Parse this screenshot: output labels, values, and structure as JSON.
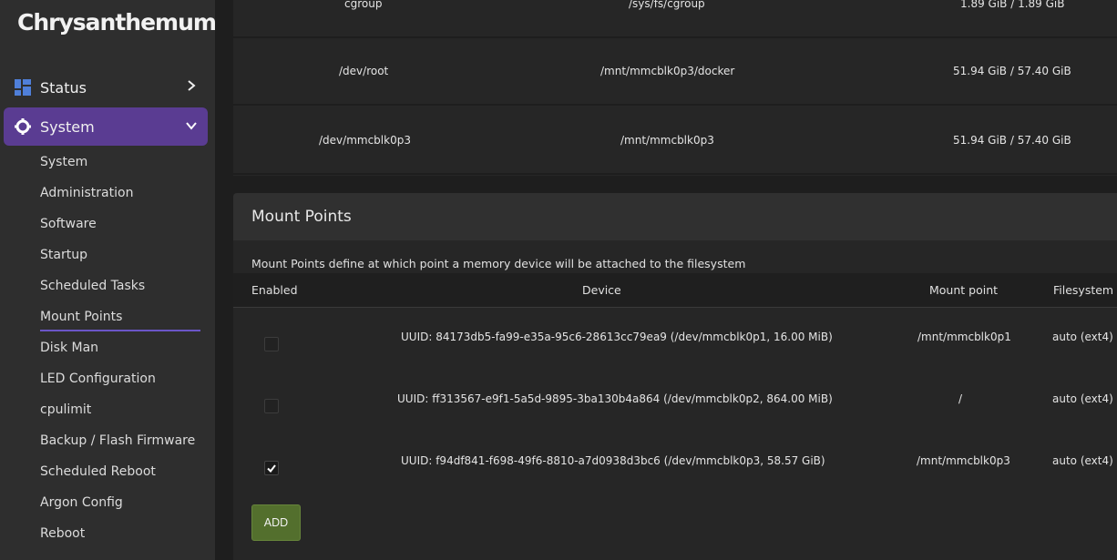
{
  "brand": "Chrysanthemum",
  "nav": {
    "status_label": "Status",
    "system_label": "System",
    "sub_items": [
      "System",
      "Administration",
      "Software",
      "Startup",
      "Scheduled Tasks",
      "Mount Points",
      "Disk Man",
      "LED Configuration",
      "cpulimit",
      "Backup / Flash Firmware",
      "Scheduled Reboot",
      "Argon Config",
      "Reboot"
    ]
  },
  "disk_rows": [
    {
      "fs": "cgroup",
      "mount": "/sys/fs/cgroup",
      "usage": "1.89 GiB / 1.89 GiB"
    },
    {
      "fs": "/dev/root",
      "mount": "/mnt/mmcblk0p3/docker",
      "usage": "51.94 GiB / 57.40 GiB"
    },
    {
      "fs": "/dev/mmcblk0p3",
      "mount": "/mnt/mmcblk0p3",
      "usage": "51.94 GiB / 57.40 GiB"
    }
  ],
  "mount_points": {
    "title": "Mount Points",
    "description": "Mount Points define at which point a memory device will be attached to the filesystem",
    "headers": {
      "enabled": "Enabled",
      "device": "Device",
      "mount_point": "Mount point",
      "filesystem": "Filesystem"
    },
    "rows": [
      {
        "enabled": false,
        "device": "UUID: 84173db5-fa99-e35a-95c6-28613cc79ea9 (/dev/mmcblk0p1, 16.00 MiB)",
        "mount_point": "/mnt/mmcblk0p1",
        "filesystem": "auto (ext4)"
      },
      {
        "enabled": false,
        "device": "UUID: ff313567-e9f1-5a5d-9895-3ba130b4a864 (/dev/mmcblk0p2, 864.00 MiB)",
        "mount_point": "/",
        "filesystem": "auto (ext4)"
      },
      {
        "enabled": true,
        "device": "UUID: f94df841-f698-49f6-8810-a7d0938d3bc6 (/dev/mmcblk0p3, 58.57 GiB)",
        "mount_point": "/mnt/mmcblk0p3",
        "filesystem": "auto (ext4)"
      }
    ],
    "add_label": "ADD"
  },
  "colors": {
    "accent": "#5a3c92",
    "add_button": "#536f2d"
  }
}
